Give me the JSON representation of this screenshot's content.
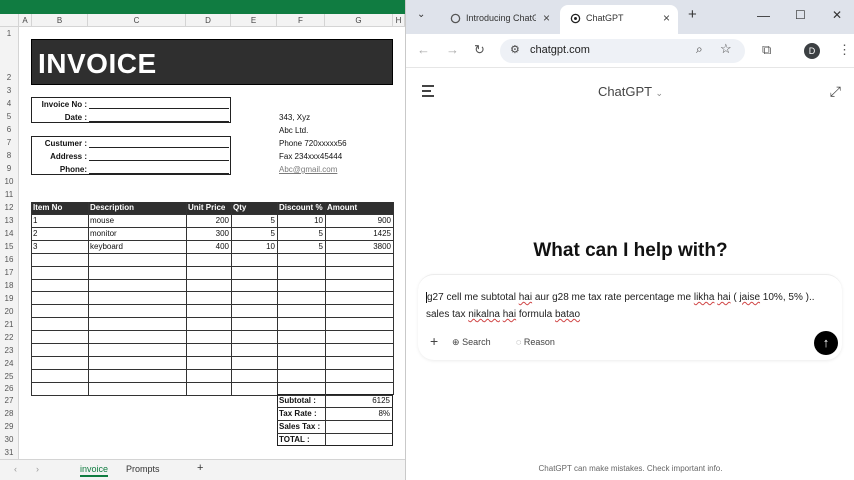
{
  "excel": {
    "columns": [
      "A",
      "B",
      "C",
      "D",
      "E",
      "F",
      "G",
      "H"
    ],
    "rows": [
      "1",
      "2",
      "3",
      "4",
      "5",
      "6",
      "7",
      "8",
      "9",
      "10",
      "11",
      "12",
      "13",
      "14",
      "15",
      "16",
      "17",
      "18",
      "19",
      "20",
      "21",
      "22",
      "23",
      "24",
      "25",
      "26",
      "27",
      "28",
      "29",
      "30",
      "31"
    ],
    "title": "INVOICE",
    "labels": {
      "invoice_no": "Invoice No :",
      "date": "Date :",
      "customer": "Custumer :",
      "address": "Address :",
      "phone": "Phone:"
    },
    "company": {
      "address": "343, Xyz",
      "name": "Abc Ltd.",
      "phone": "Phone 720xxxxx56",
      "fax": "Fax 234xxx45444",
      "email": "Abc@gmail.com"
    },
    "table_headers": [
      "Item No",
      "Description",
      "Unit Price",
      "Qty",
      "Discount %",
      "Amount"
    ],
    "items": [
      {
        "no": "1",
        "desc": "mouse",
        "price": "200",
        "qty": "5",
        "disc": "10",
        "amount": "900"
      },
      {
        "no": "2",
        "desc": "monitor",
        "price": "300",
        "qty": "5",
        "disc": "5",
        "amount": "1425"
      },
      {
        "no": "3",
        "desc": "keyboard",
        "price": "400",
        "qty": "10",
        "disc": "5",
        "amount": "3800"
      }
    ],
    "totals": {
      "subtotal_label": "Subtotal :",
      "subtotal": "6125",
      "taxrate_label": "Tax Rate :",
      "taxrate": "8%",
      "salestax_label": "Sales Tax :",
      "total_label": "TOTAL :"
    },
    "sheet_tabs": [
      "invoice",
      "Prompts"
    ],
    "add_sheet": "+"
  },
  "browser": {
    "tabs": [
      {
        "label": "Introducing ChatGPT"
      },
      {
        "label": "ChatGPT"
      }
    ],
    "new_tab": "+",
    "url": "chatgpt.com",
    "avatar": "D",
    "window_controls": {
      "minimize": "—",
      "maximize": "☐",
      "close": "✕"
    }
  },
  "chatgpt": {
    "title": "ChatGPT",
    "hero": "What can I help with?",
    "prompt_parts": [
      {
        "t": "g27 cell me subtotal ",
        "sq": false
      },
      {
        "t": "hai",
        "sq": true
      },
      {
        "t": " aur g28 me tax rate percentage me ",
        "sq": false
      },
      {
        "t": "likha",
        "sq": true
      },
      {
        "t": " ",
        "sq": false
      },
      {
        "t": "hai",
        "sq": true
      },
      {
        "t": " ( ",
        "sq": false
      },
      {
        "t": "jaise",
        "sq": true
      },
      {
        "t": " 10%, 5% ).. sales tax ",
        "sq": false
      },
      {
        "t": "nikalna",
        "sq": true
      },
      {
        "t": " ",
        "sq": false
      },
      {
        "t": "hai",
        "sq": true
      },
      {
        "t": " formula ",
        "sq": false
      },
      {
        "t": "batao",
        "sq": true
      }
    ],
    "attach": "+",
    "search_label": "Search",
    "reason_label": "Reason",
    "send": "↑",
    "footer": "ChatGPT can make mistakes. Check important info."
  }
}
